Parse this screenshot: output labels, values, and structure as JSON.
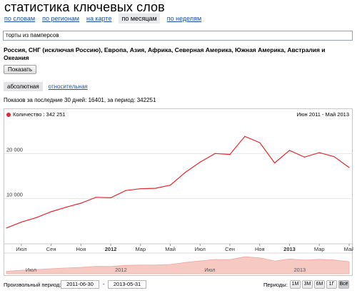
{
  "header": {
    "title": "статистика ключевых слов"
  },
  "nav": [
    {
      "label": "по словам",
      "active": false
    },
    {
      "label": "по регионам",
      "active": false
    },
    {
      "label": "на карте",
      "active": false
    },
    {
      "label": "по месяцам",
      "active": true
    },
    {
      "label": "по неделям",
      "active": false
    }
  ],
  "search": {
    "value": "торты из памперсов"
  },
  "regions": "Россия, СНГ (исключая Россию), Европа, Азия, Африка, Северная Америка, Южная Америка, Австралия и Океания",
  "show_button": "Показать",
  "mode_tabs": {
    "absolute": "абсолютная",
    "relative": "относительная"
  },
  "summary": "Показов за последние 30 дней: 16401, за период: 342251",
  "chart_data": {
    "type": "line",
    "title": "",
    "legend": "Количество : 342 251",
    "period_label": "Июн 2011 - Май 2013",
    "series_color": "#e8262b",
    "x": [
      "2011-06",
      "2011-07",
      "2011-08",
      "2011-09",
      "2011-10",
      "2011-11",
      "2011-12",
      "2012-01",
      "2012-02",
      "2012-03",
      "2012-04",
      "2012-05",
      "2012-06",
      "2012-07",
      "2012-08",
      "2012-09",
      "2012-10",
      "2012-11",
      "2012-12",
      "2013-01",
      "2013-02",
      "2013-03",
      "2013-04",
      "2013-05"
    ],
    "values": [
      3500,
      4800,
      5800,
      7100,
      8100,
      9000,
      10300,
      10200,
      11800,
      12200,
      12300,
      13000,
      15800,
      18100,
      20000,
      19800,
      23800,
      22400,
      17900,
      20700,
      19200,
      20200,
      19300,
      16900
    ],
    "ylim": [
      0,
      27000
    ],
    "yticks": [
      "10 000",
      "20 000"
    ],
    "ytick_values": [
      10000,
      20000
    ],
    "xticks": [
      {
        "label": "Июл",
        "i": 1,
        "bold": false
      },
      {
        "label": "Сен",
        "i": 3,
        "bold": false
      },
      {
        "label": "Ноя",
        "i": 5,
        "bold": false
      },
      {
        "label": "2012",
        "i": 7,
        "bold": true
      },
      {
        "label": "Мар",
        "i": 9,
        "bold": false
      },
      {
        "label": "Май",
        "i": 11,
        "bold": false
      },
      {
        "label": "Июл",
        "i": 13,
        "bold": false
      },
      {
        "label": "Сен",
        "i": 15,
        "bold": false
      },
      {
        "label": "Ноя",
        "i": 17,
        "bold": false
      },
      {
        "label": "2013",
        "i": 19,
        "bold": true
      },
      {
        "label": "Мар",
        "i": 21,
        "bold": false
      },
      {
        "label": "Май",
        "i": 23,
        "bold": false
      }
    ],
    "navigator_ticks": [
      {
        "label": "Июл",
        "i": 1
      },
      {
        "label": "2012",
        "i": 7
      },
      {
        "label": "Июл",
        "i": 13
      },
      {
        "label": "2013",
        "i": 19
      }
    ],
    "grid": true
  },
  "bottom": {
    "custom_period_label": "Произвольный период:",
    "date_from": "2011-06-30",
    "dash": "-",
    "date_to": "2013-05-31",
    "periods_label": "Периоды:",
    "period_buttons": [
      "1М",
      "3М",
      "6М",
      "1Г",
      "Всё"
    ],
    "selected_period": "Всё"
  }
}
